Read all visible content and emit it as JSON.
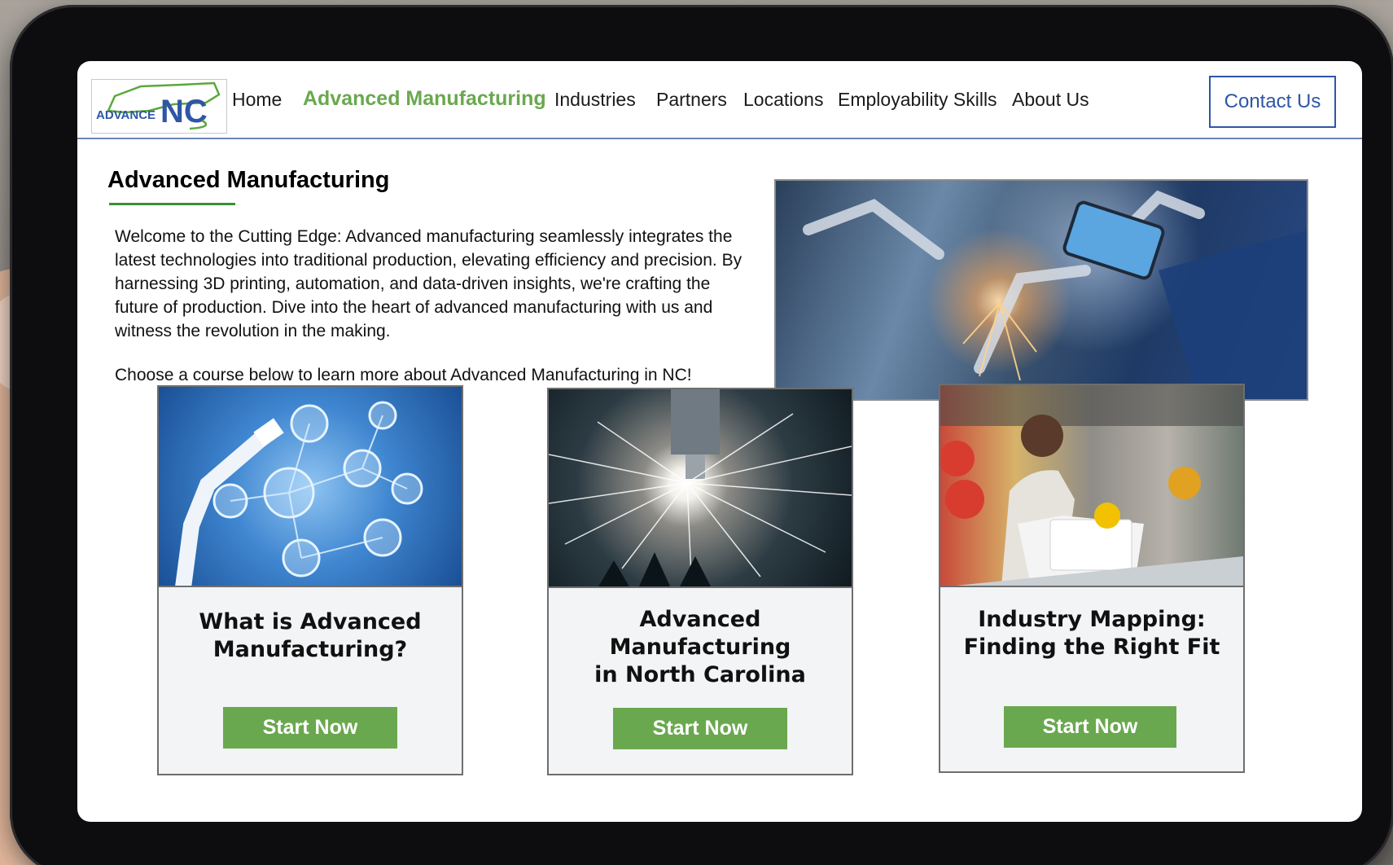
{
  "logo": {
    "text_advance": "ADVANCE",
    "text_nc": "NC"
  },
  "nav": {
    "items": [
      {
        "label": "Home",
        "active": false
      },
      {
        "label": "Advanced Manufacturing",
        "active": true
      },
      {
        "label": "Industries",
        "active": false
      },
      {
        "label": "Partners",
        "active": false
      },
      {
        "label": "Locations",
        "active": false
      },
      {
        "label": "Employability Skills",
        "active": false
      },
      {
        "label": "About Us",
        "active": false
      }
    ],
    "contact_label": "Contact Us"
  },
  "page": {
    "title": "Advanced Manufacturing",
    "intro": "Welcome to the Cutting Edge: Advanced manufacturing seamlessly integrates the latest technologies into traditional production, elevating efficiency and precision. By harnessing 3D printing, automation, and data-driven insights, we're crafting the future of production. Dive into the heart of advanced manufacturing with us and witness the revolution in the making.",
    "cta_text": "Choose a course below to learn more about Advanced Manufacturing in NC!"
  },
  "courses": [
    {
      "title_line1": "What is Advanced",
      "title_line2": "Manufacturing?",
      "button": "Start Now",
      "image": "robot-arm-network"
    },
    {
      "title_line1": "Advanced Manufacturing",
      "title_line2": "in North Carolina",
      "button": "Start Now",
      "image": "laser-cutting-sparks"
    },
    {
      "title_line1": "Industry Mapping:",
      "title_line2": "Finding the Right Fit",
      "button": "Start Now",
      "image": "worker-laptop-factory"
    }
  ],
  "colors": {
    "accent_green": "#6aa84f",
    "contact_blue": "#2f56a6",
    "underline_green": "#3a8f3a",
    "divider_blue": "#6a87b8"
  }
}
